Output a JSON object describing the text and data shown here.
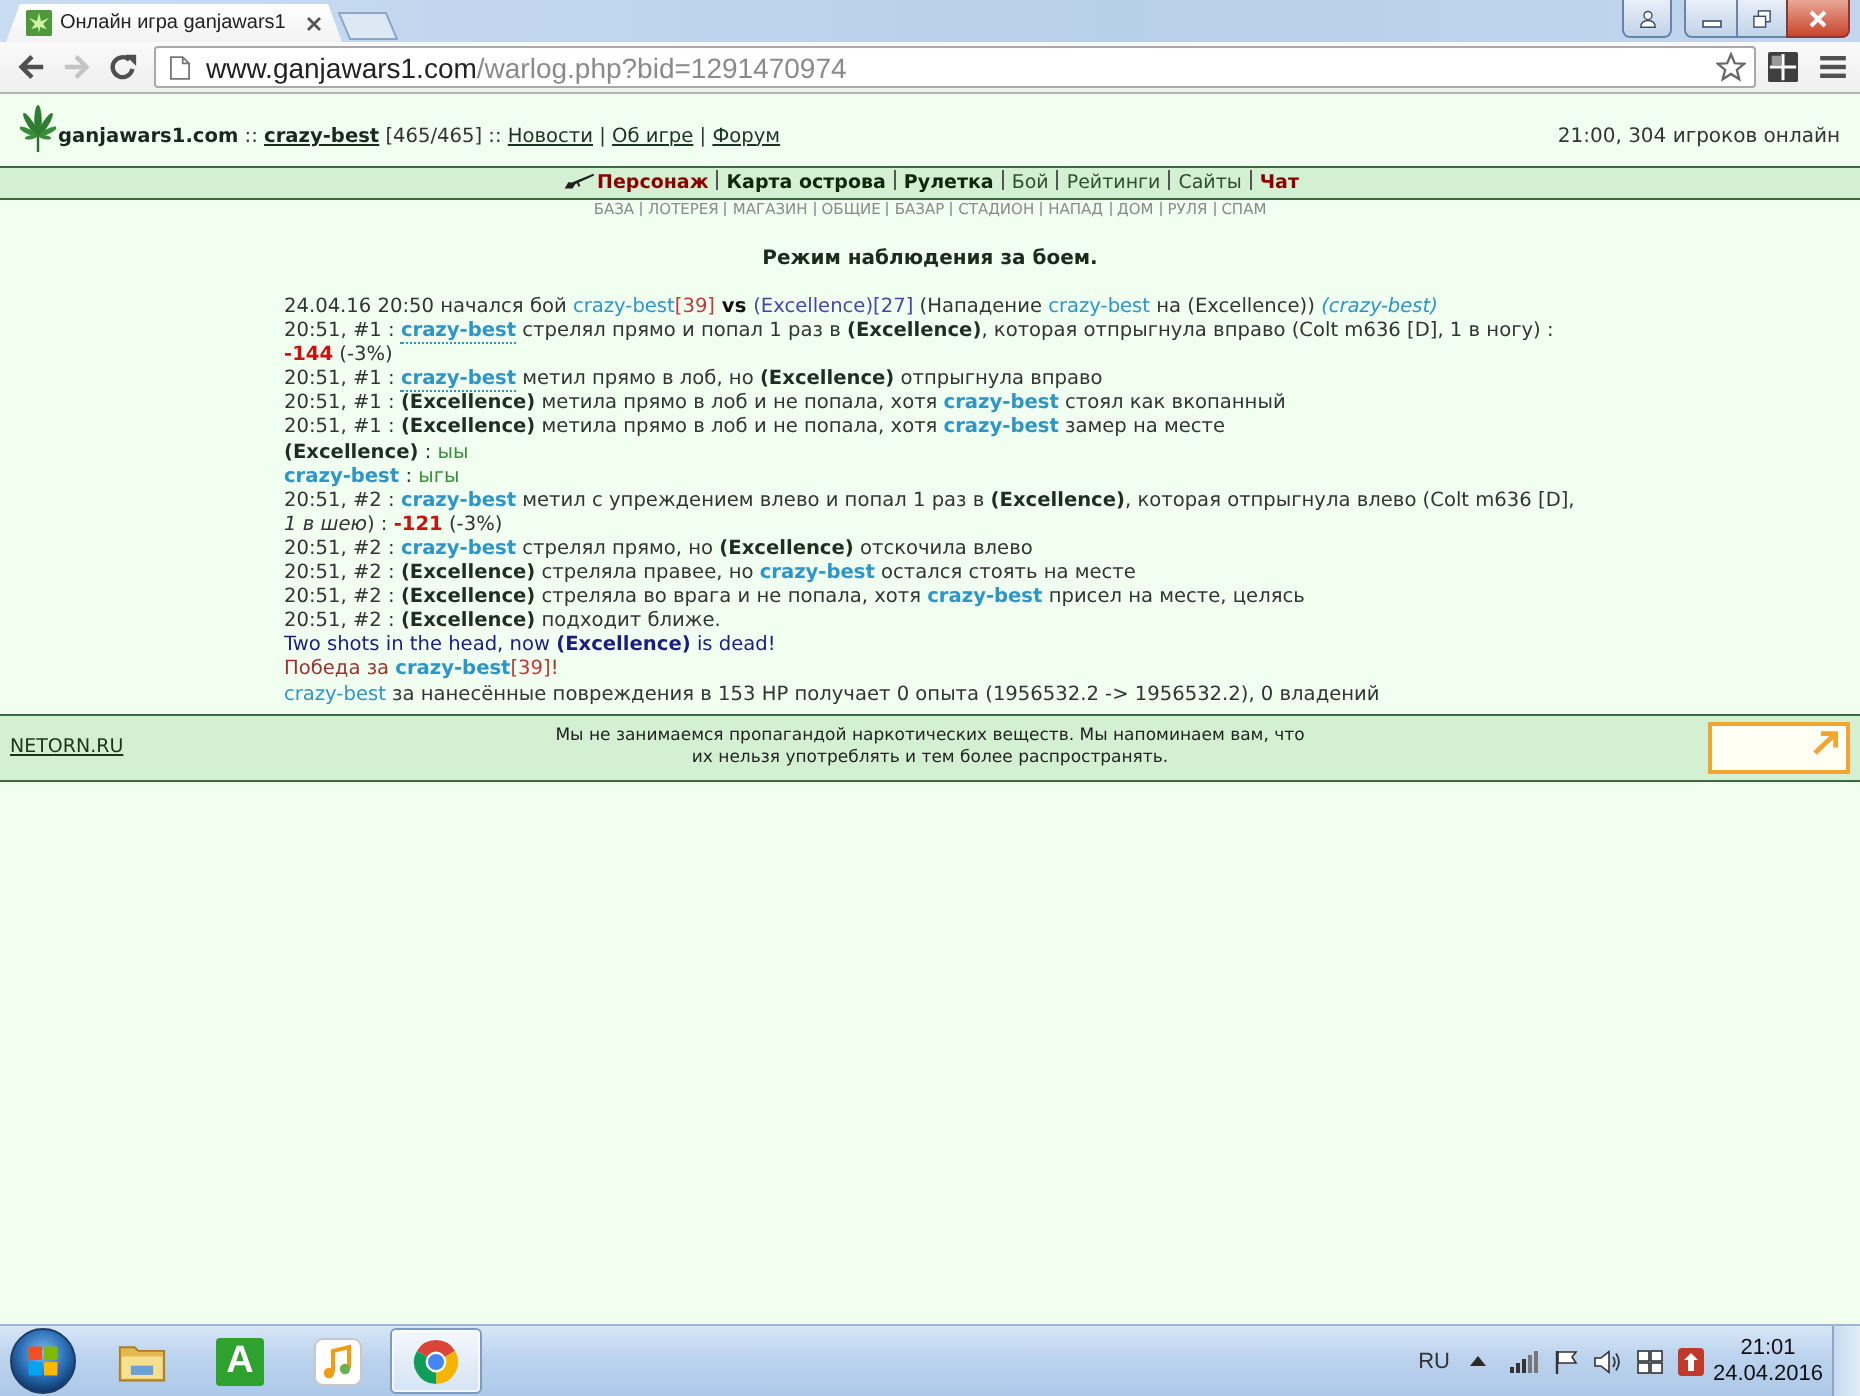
{
  "browser": {
    "tab": {
      "title": "Онлайн игра ganjawars1"
    },
    "nav_buttons": [
      {
        "kind": "back",
        "disabled": false
      },
      {
        "kind": "forward",
        "disabled": true
      }
    ],
    "address": {
      "host": "www.ganjawars1.com",
      "path": "/warlog.php?bid=1291470974"
    }
  },
  "header": {
    "segments": [
      {
        "kind": "brand",
        "text": "ganjawars1.com"
      },
      {
        "kind": "plain",
        "text": " :: "
      },
      {
        "kind": "user",
        "text": "crazy-best"
      },
      {
        "kind": "plain",
        "text": " [465/465] :: "
      },
      {
        "kind": "link",
        "text": "Новости"
      },
      {
        "kind": "plain",
        "text": " | "
      },
      {
        "kind": "link",
        "text": "Об игре"
      },
      {
        "kind": "plain",
        "text": " | "
      },
      {
        "kind": "link",
        "text": "Форум"
      }
    ],
    "online": "21:00, 304 игроков онлайн"
  },
  "menu": {
    "items": [
      {
        "label": "Персонаж",
        "kind": "accent"
      },
      {
        "label": "Карта острова",
        "kind": "major"
      },
      {
        "label": "Рулетка",
        "kind": "major"
      },
      {
        "label": "Бой",
        "kind": "minor"
      },
      {
        "label": "Рейтинги",
        "kind": "minor"
      },
      {
        "label": "Сайты",
        "kind": "minor"
      },
      {
        "label": "Чат",
        "kind": "accent"
      }
    ]
  },
  "submenu": {
    "items": [
      "БАЗА",
      "ЛОТЕРЕЯ",
      "МАГАЗИН",
      "ОБЩИЕ",
      "БАЗАР",
      "СТАДИОН",
      "НАПАД",
      "ДОМ",
      "РУЛЯ",
      "СПАМ"
    ]
  },
  "log": {
    "title": "Режим наблюдения за боем.",
    "lines": [
      {
        "segments": [
          {
            "kind": "plain",
            "text": "24.04.16 20:50 начался бой "
          },
          {
            "kind": "player-light",
            "text": "crazy-best"
          },
          {
            "kind": "level",
            "text": "[39]"
          },
          {
            "kind": "strong",
            "text": " vs "
          },
          {
            "kind": "enemy-light",
            "text": "(Excellence)"
          },
          {
            "kind": "level-enemy",
            "text": "[27]"
          },
          {
            "kind": "plain",
            "text": " (Нападение "
          },
          {
            "kind": "player-light",
            "text": "crazy-best"
          },
          {
            "kind": "plain",
            "text": " на (Excellence)) "
          },
          {
            "kind": "player-italic",
            "text": "(crazy-best)"
          }
        ]
      },
      {
        "segments": [
          {
            "kind": "plain",
            "text": "20:51, #1 : "
          },
          {
            "kind": "player-marked",
            "text": "crazy-best"
          },
          {
            "kind": "plain",
            "text": " стрелял прямо и попал 1 раз в "
          },
          {
            "kind": "enemy",
            "text": "(Excellence)"
          },
          {
            "kind": "plain",
            "text": ", которая отпрыгнула вправо (Colt m636 [D], 1 в ногу) : "
          },
          {
            "kind": "damage",
            "text": "-144"
          },
          {
            "kind": "plain",
            "text": " (-3%)"
          }
        ]
      },
      {
        "segments": [
          {
            "kind": "plain",
            "text": "20:51, #1 : "
          },
          {
            "kind": "player-marked",
            "text": "crazy-best"
          },
          {
            "kind": "plain",
            "text": " метил прямо в лоб, но "
          },
          {
            "kind": "enemy",
            "text": "(Excellence)"
          },
          {
            "kind": "plain",
            "text": " отпрыгнула вправо"
          }
        ]
      },
      {
        "segments": [
          {
            "kind": "plain",
            "text": "20:51, #1 : "
          },
          {
            "kind": "enemy",
            "text": "(Excellence)"
          },
          {
            "kind": "plain",
            "text": " метила прямо в лоб и не попала, хотя "
          },
          {
            "kind": "player",
            "text": "crazy-best"
          },
          {
            "kind": "plain",
            "text": " стоял как вкопанный"
          }
        ]
      },
      {
        "segments": [
          {
            "kind": "plain",
            "text": "20:51, #1 : "
          },
          {
            "kind": "enemy",
            "text": "(Excellence)"
          },
          {
            "kind": "plain",
            "text": " метила прямо в лоб и не попала, хотя "
          },
          {
            "kind": "player",
            "text": "crazy-best"
          },
          {
            "kind": "plain",
            "text": " замер на месте"
          }
        ]
      },
      {
        "segments": [
          {
            "kind": "enemy",
            "text": "(Excellence)"
          },
          {
            "kind": "plain",
            "text": " : "
          },
          {
            "kind": "chat",
            "text": "ыы"
          }
        ]
      },
      {
        "segments": [
          {
            "kind": "player",
            "text": "crazy-best"
          },
          {
            "kind": "plain",
            "text": " : "
          },
          {
            "kind": "chat",
            "text": "ыгы"
          }
        ]
      },
      {
        "segments": [
          {
            "kind": "plain",
            "text": "20:51, #2 : "
          },
          {
            "kind": "player",
            "text": "crazy-best"
          },
          {
            "kind": "plain",
            "text": " метил с упреждением влево и попал 1 раз в "
          },
          {
            "kind": "enemy",
            "text": "(Excellence)"
          },
          {
            "kind": "plain",
            "text": ", которая отпрыгнула влево (Colt m636 [D], "
          },
          {
            "kind": "italic",
            "text": "1 в шею"
          },
          {
            "kind": "plain",
            "text": ") : "
          },
          {
            "kind": "damage",
            "text": "-121"
          },
          {
            "kind": "plain",
            "text": " (-3%)"
          }
        ]
      },
      {
        "segments": [
          {
            "kind": "plain",
            "text": "20:51, #2 : "
          },
          {
            "kind": "player",
            "text": "crazy-best"
          },
          {
            "kind": "plain",
            "text": " стрелял прямо, но "
          },
          {
            "kind": "enemy",
            "text": "(Excellence)"
          },
          {
            "kind": "plain",
            "text": " отскочила влево"
          }
        ]
      },
      {
        "segments": [
          {
            "kind": "plain",
            "text": "20:51, #2 : "
          },
          {
            "kind": "enemy",
            "text": "(Excellence)"
          },
          {
            "kind": "plain",
            "text": " стреляла правее, но "
          },
          {
            "kind": "player",
            "text": "crazy-best"
          },
          {
            "kind": "plain",
            "text": " остался стоять на месте"
          }
        ]
      },
      {
        "segments": [
          {
            "kind": "plain",
            "text": "20:51, #2 : "
          },
          {
            "kind": "enemy",
            "text": "(Excellence)"
          },
          {
            "kind": "plain",
            "text": " стреляла во врага и не попала, хотя "
          },
          {
            "kind": "player",
            "text": "crazy-best"
          },
          {
            "kind": "plain",
            "text": " присел на месте, целясь"
          }
        ]
      },
      {
        "segments": [
          {
            "kind": "plain",
            "text": "20:51, #2 : "
          },
          {
            "kind": "enemy",
            "text": "(Excellence)"
          },
          {
            "kind": "plain",
            "text": " подходит ближе."
          }
        ]
      },
      {
        "segments": [
          {
            "kind": "dead",
            "text": "Two shots in the head, now "
          },
          {
            "kind": "dead-bold",
            "text": "(Excellence)"
          },
          {
            "kind": "dead",
            "text": " is dead!"
          }
        ]
      },
      {
        "segments": [
          {
            "kind": "win",
            "text": "Победа за "
          },
          {
            "kind": "player",
            "text": "crazy-best"
          },
          {
            "kind": "level",
            "text": "[39]"
          },
          {
            "kind": "win",
            "text": "!"
          }
        ]
      },
      {
        "segments": [
          {
            "kind": "player-light",
            "text": "crazy-best"
          },
          {
            "kind": "plain",
            "text": " за нанесённые повреждения в 153 HP получает 0 опыта (1956532.2 -> 1956532.2), 0 владений"
          }
        ]
      }
    ]
  },
  "footer": {
    "link": "NETORN.RU",
    "notice": [
      "Мы не занимаемся пропагандой наркотических веществ. Мы напоминаем вам, что",
      "их нельзя употреблять и тем более распространять."
    ]
  },
  "taskbar": {
    "apps": [
      {
        "kind": "folder",
        "selected": false
      },
      {
        "kind": "letter",
        "label": "A",
        "selected": false
      },
      {
        "kind": "music",
        "selected": false
      },
      {
        "kind": "browser",
        "selected": true
      }
    ],
    "language": "RU",
    "time": "21:01",
    "date": "24.04.2016"
  }
}
